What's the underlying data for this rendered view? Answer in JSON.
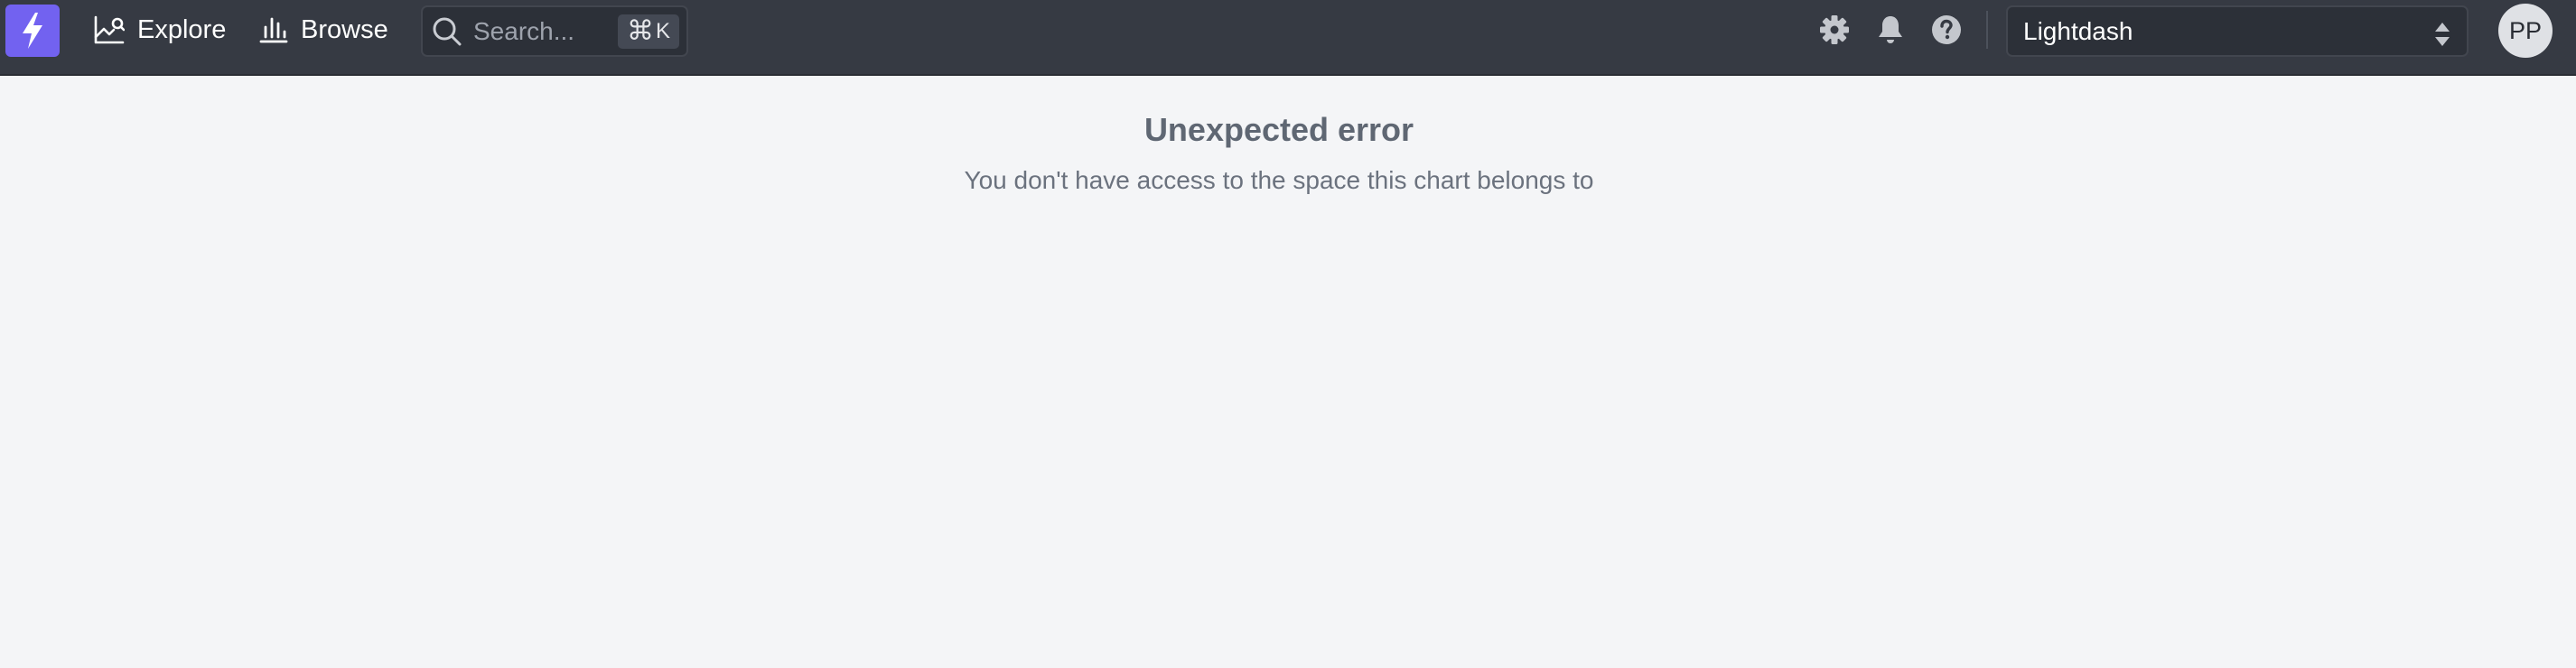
{
  "nav": {
    "explore_label": "Explore",
    "browse_label": "Browse"
  },
  "search": {
    "placeholder": "Search...",
    "shortcut_symbol": "⌘",
    "shortcut_key": "K"
  },
  "project_selector": {
    "value": "Lightdash"
  },
  "user": {
    "initials": "PP"
  },
  "error": {
    "title": "Unexpected error",
    "message": "You don't have access to the space this chart belongs to"
  },
  "colors": {
    "topbar_bg": "#363a43",
    "brand_accent": "#7262f0",
    "page_bg": "#f4f5f7"
  },
  "icons": [
    "lightning-logo-icon",
    "chart-explore-icon",
    "bar-chart-icon",
    "search-icon",
    "gear-icon",
    "bell-icon",
    "help-icon",
    "select-arrows-icon"
  ]
}
